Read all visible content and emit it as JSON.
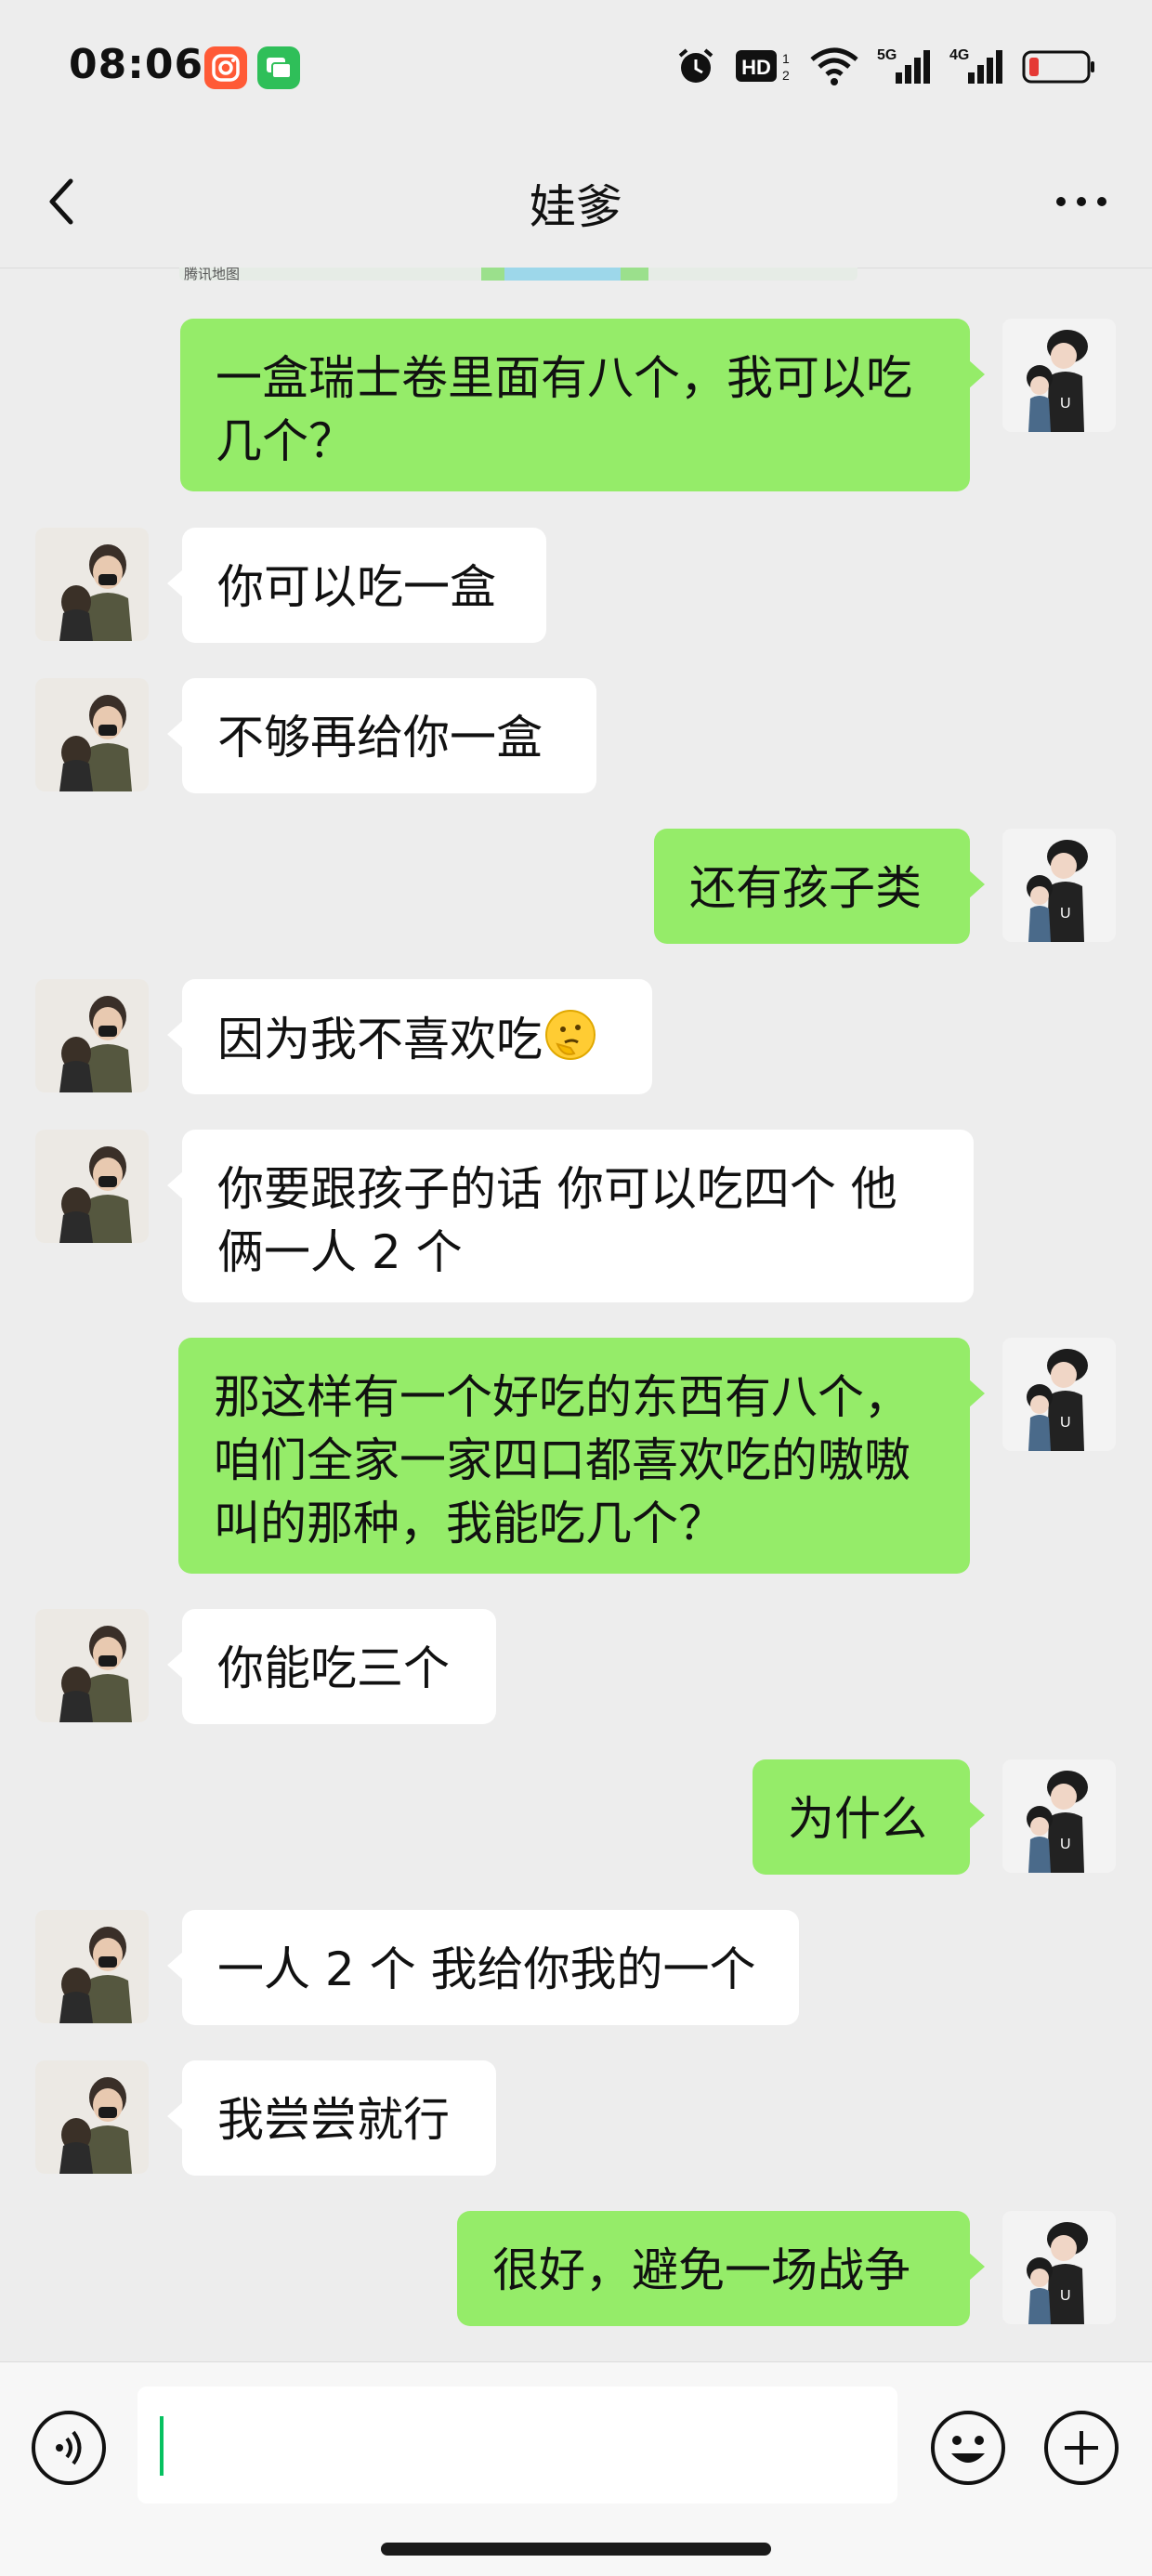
{
  "status_bar": {
    "time": "08:06",
    "icons": [
      "instagram-like-app-icon",
      "messages-app-icon",
      "alarm-icon",
      "hd-icon",
      "wifi-icon",
      "signal-5g-icon",
      "signal-4g-icon",
      "battery-low-icon"
    ],
    "hd_label": "HD",
    "net1_label": "5G",
    "net2_label": "4G",
    "battery_color": "#e53935"
  },
  "header": {
    "title": "娃爹",
    "back_icon": "chevron-left-icon",
    "more_icon": "more-dots-icon"
  },
  "map_snippet": {
    "label": "腾讯地图"
  },
  "messages": [
    {
      "side": "right",
      "text": "一盒瑞士卷里面有八个，我可以吃几个？"
    },
    {
      "side": "left",
      "text": "你可以吃一盒"
    },
    {
      "side": "left",
      "text": "不够再给你一盒"
    },
    {
      "side": "right",
      "text": "还有孩子类"
    },
    {
      "side": "left",
      "text": "因为我不喜欢吃",
      "emoji": "thinking-face-icon"
    },
    {
      "side": "left",
      "text": "你要跟孩子的话 你可以吃四个 他俩一人 2 个"
    },
    {
      "side": "right",
      "text": "那这样有一个好吃的东西有八个，咱们全家一家四口都喜欢吃的嗷嗷叫的那种，我能吃几个？"
    },
    {
      "side": "left",
      "text": "你能吃三个"
    },
    {
      "side": "right",
      "text": "为什么"
    },
    {
      "side": "left",
      "text": "一人 2 个 我给你我的一个"
    },
    {
      "side": "left",
      "text": "我尝尝就行"
    },
    {
      "side": "right",
      "text": "很好，避免一场战争"
    }
  ],
  "input_bar": {
    "input_value": "",
    "icons": [
      "voice-icon",
      "emoji-icon",
      "plus-icon"
    ]
  },
  "colors": {
    "accent_green": "#95ec69",
    "background": "#ededed",
    "cursor": "#07c160"
  }
}
